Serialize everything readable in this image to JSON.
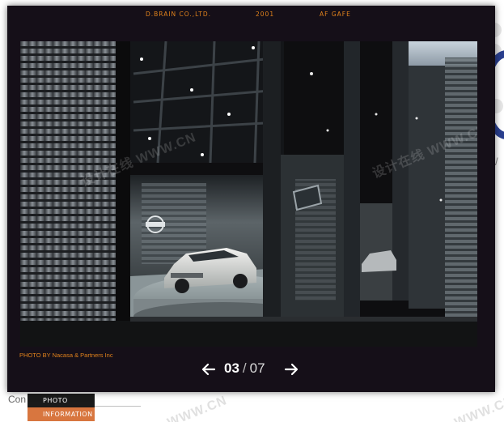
{
  "header": {
    "company": "D.BRAIN CO.,LTD.",
    "year": "2001",
    "venue": "AF GAFE"
  },
  "photo": {
    "credit": "PHOTO BY Nacasa & Partners Inc",
    "watermark_text": "WWW.CN",
    "watermark_text_cn": "设计在线"
  },
  "pager": {
    "current": "03",
    "separator": "/",
    "total": "07"
  },
  "background_page": {
    "menu": {
      "photo": "PHOTO",
      "information": "INFORMATION"
    },
    "partial_text": "Con",
    "partial_text_right": "/"
  },
  "colors": {
    "accent": "#e0821c",
    "viewer_bg": "#150f18",
    "menu_active": "#d8763f",
    "menu_dark": "#1a1a1a"
  }
}
